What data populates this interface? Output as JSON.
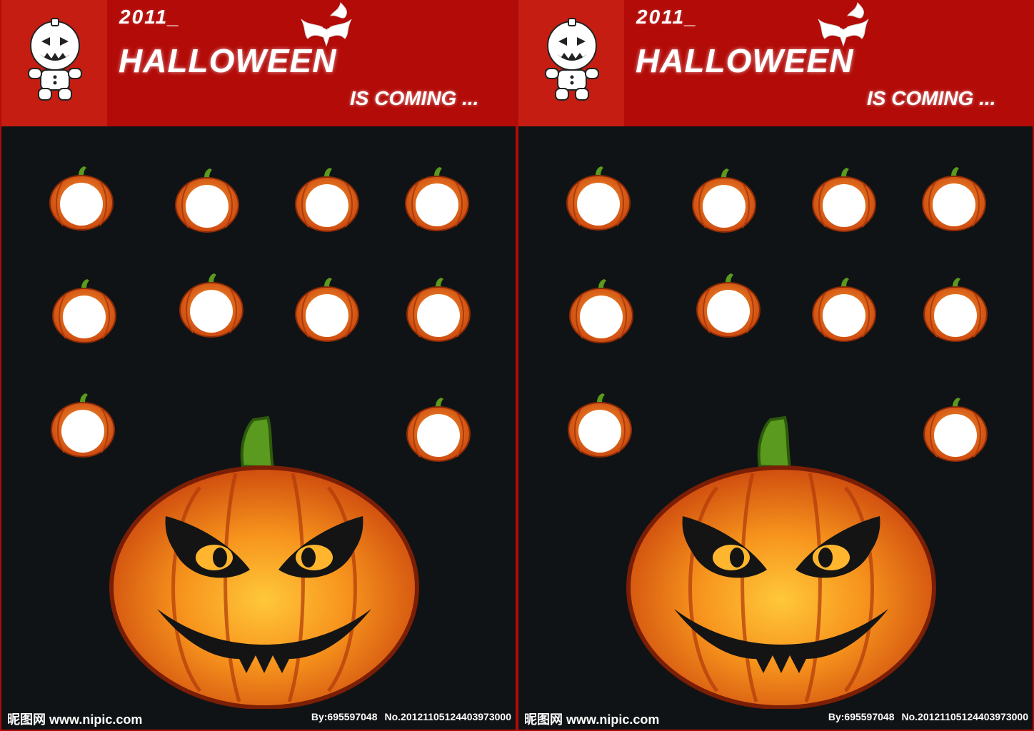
{
  "panels": [
    {
      "year": "2011_",
      "title": "HALLOWEEN",
      "subtitle": "IS COMING ...",
      "watermark": "昵图网 www.nipic.com",
      "by": "By:695597048",
      "no": "No.20121105124403973000"
    },
    {
      "year": "2011_",
      "title": "HALLOWEEN",
      "subtitle": "IS COMING ...",
      "watermark": "昵图网 www.nipic.com",
      "by": "By:695597048",
      "no": "No.20121105124403973000"
    }
  ],
  "colors": {
    "header_red": "#b30b08",
    "icon_red": "#c51d12",
    "background": "#101315",
    "pumpkin_orange": "#e8620f",
    "stem_green": "#5a9a1e"
  },
  "photo_slots_per_panel": 10
}
